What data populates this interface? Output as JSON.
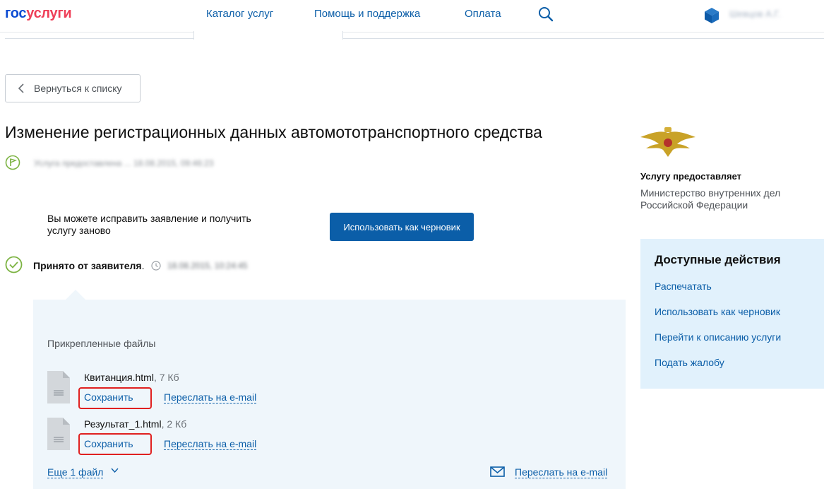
{
  "header": {
    "logo_part1": "гос",
    "logo_part2": "услуги",
    "nav": [
      "Каталог услуг",
      "Помощь и поддержка",
      "Оплата"
    ],
    "user_name": "Шевцов А.Г."
  },
  "back_button": {
    "label": "Вернуться к списку"
  },
  "page_title": "Изменение регистрационных данных автомототранспортного средства",
  "order_info": "Услуга предоставлена    ...    18.08.2015, 09:46:23",
  "draft": {
    "text": "Вы можете исправить заявление и получить услугу заново",
    "button_label": "Использовать как черновик"
  },
  "status": {
    "label": "Принято от заявителя",
    "time": "18.08.2015, 10:24:45"
  },
  "files": {
    "heading": "Прикрепленные файлы",
    "items": [
      {
        "name": "Квитанция.html",
        "size": ", 7 Кб",
        "save_label": "Сохранить",
        "mail_label": "Переслать на e-mail"
      },
      {
        "name": "Результат_1.html",
        "size": ", 2 Кб",
        "save_label": "Сохранить",
        "mail_label": "Переслать на e-mail"
      }
    ],
    "more_label": "Еще 1 файл",
    "mail_all_label": "Переслать на e-mail"
  },
  "provider": {
    "heading": "Услугу предоставляет",
    "name": "Министерство внутренних дел Российской Федерации"
  },
  "actions": {
    "title": "Доступные действия",
    "items": [
      "Распечатать",
      "Использовать как черновик",
      "Перейти к описанию услуги",
      "Подать жалобу"
    ]
  },
  "colors": {
    "accent": "#0b5ea8",
    "highlight": "#e02020",
    "panel_bg": "#eff6fb",
    "sidebar_bg": "#e1f1fc",
    "success": "#7cb342"
  }
}
